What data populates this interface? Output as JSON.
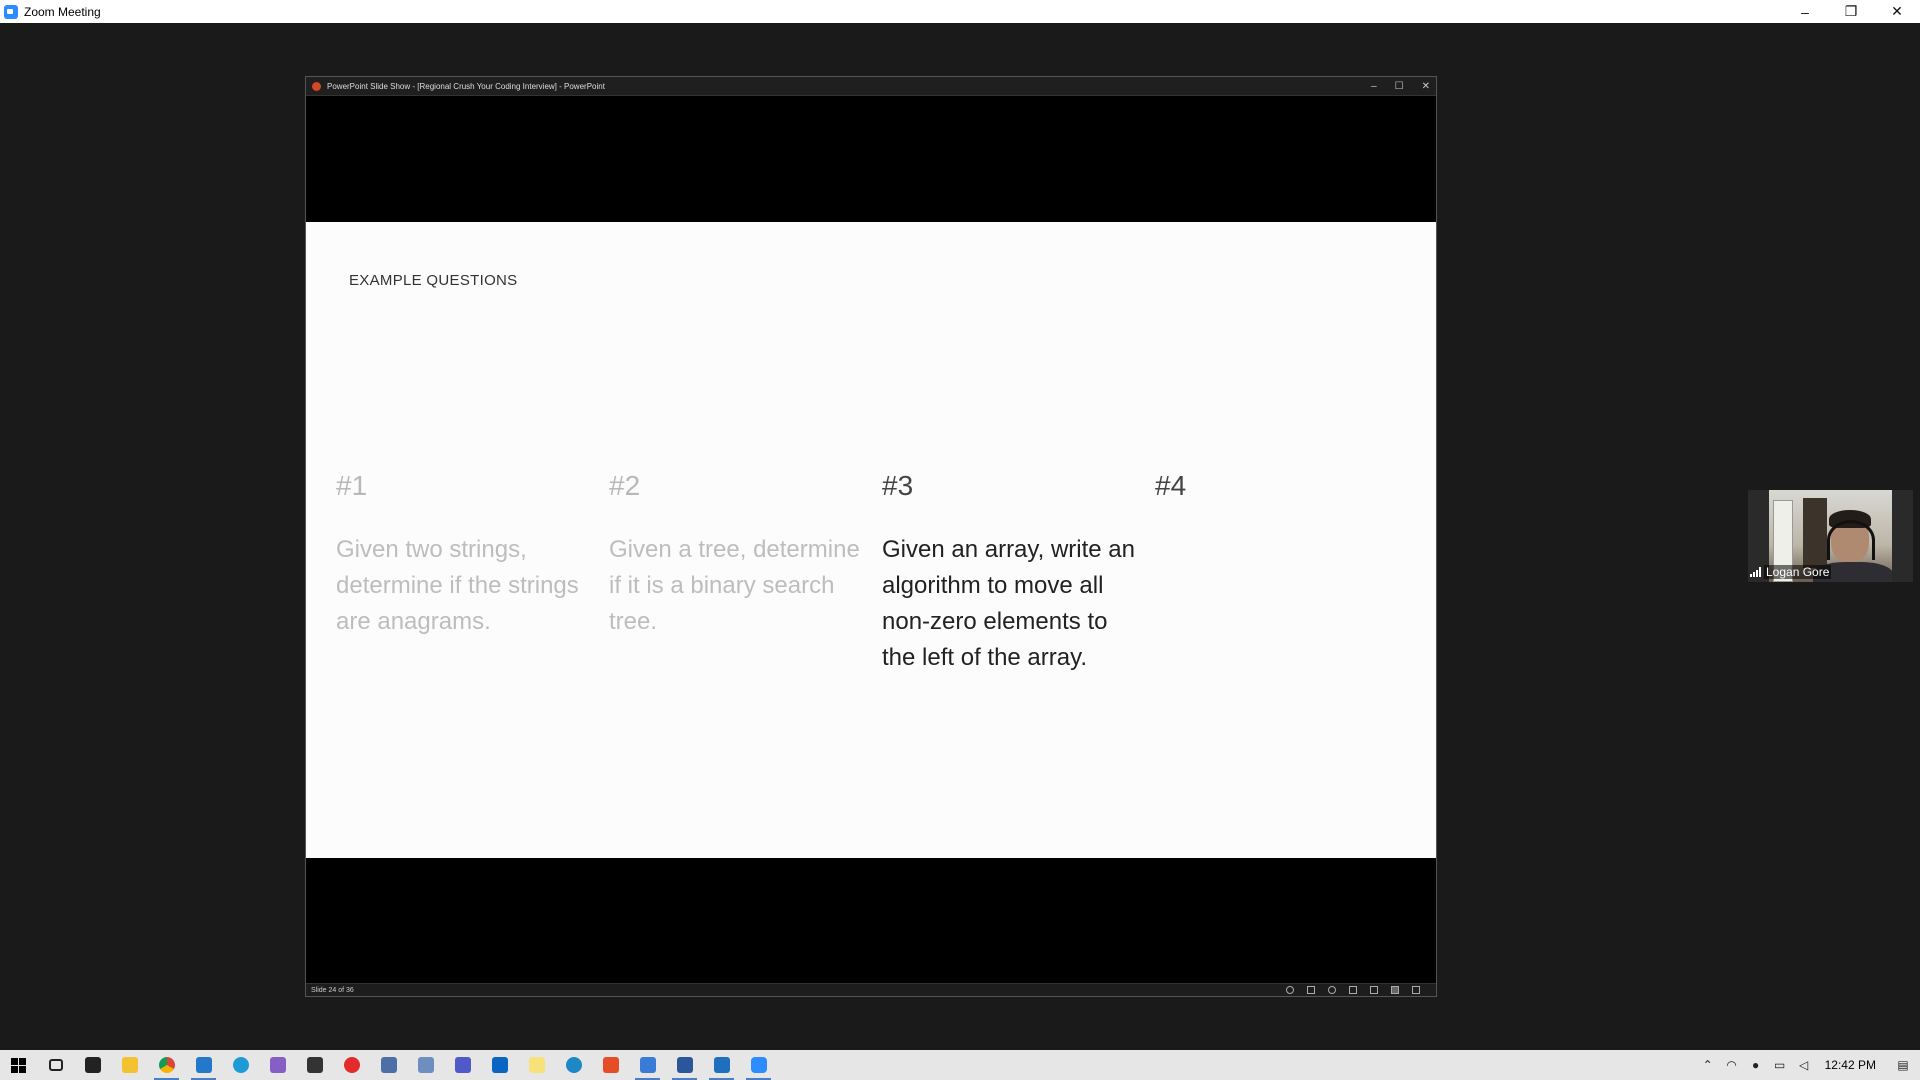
{
  "zoom": {
    "window_title": "Zoom Meeting",
    "controls": {
      "minimize": "–",
      "restore": "❐",
      "close": "✕"
    }
  },
  "powerpoint": {
    "window_title": "PowerPoint Slide Show - [Regional Crush Your Coding Interview] - PowerPoint",
    "controls": {
      "minimize": "–",
      "restore": "☐",
      "close": "✕"
    },
    "status": {
      "slide_indicator": "Slide 24 of 36"
    }
  },
  "slide": {
    "heading": "EXAMPLE QUESTIONS",
    "questions": [
      {
        "number": "#1",
        "text": "Given two strings, determine if the strings are anagrams."
      },
      {
        "number": "#2",
        "text": "Given a tree, determine if it is a binary search tree."
      },
      {
        "number": "#3",
        "text": "Given an array, write an algorithm to move all non-zero elements to the left of the array."
      },
      {
        "number": "#4",
        "text": ""
      }
    ]
  },
  "participant": {
    "name": "Logan Gore"
  },
  "taskbar": {
    "icons": [
      "windows-start-icon",
      "task-view-icon",
      "terminal-icon",
      "file-explorer-icon",
      "chrome-icon",
      "vscode-icon",
      "edge-icon",
      "visual-studio-icon",
      "terminal-app-icon",
      "record-icon",
      "remote-icon",
      "app-icon",
      "teams-icon",
      "outlook-icon",
      "sticky-icon",
      "c-app-icon",
      "office-icon",
      "remote-desktop-icon",
      "word-icon",
      "calculator-icon",
      "zoom-icon"
    ],
    "clock": "12:42 PM"
  },
  "colors": {
    "zoom_accent": "#2d8cff",
    "ppt_accent": "#d24726",
    "dim_text": "#bdbdbd",
    "active_text": "#222222"
  }
}
